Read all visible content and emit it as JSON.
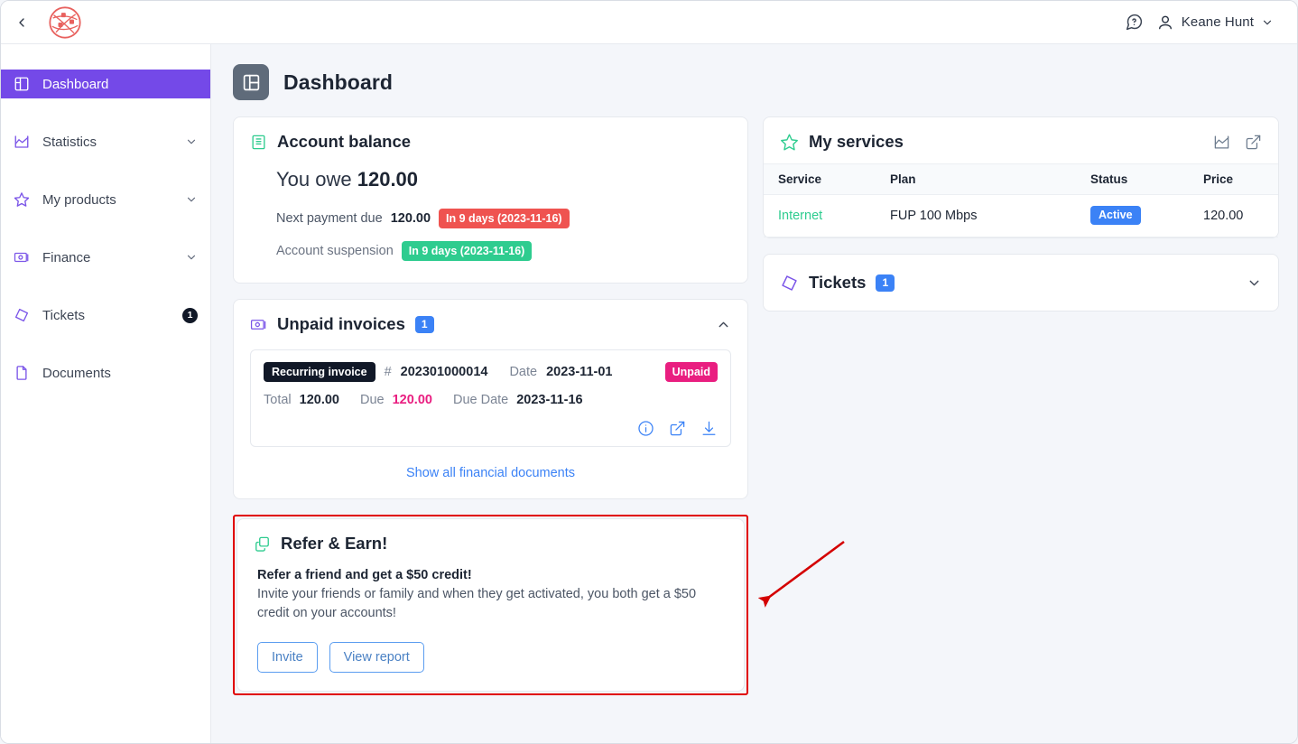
{
  "topbar": {
    "back_icon": "chevron-left-icon",
    "logo_alt": "network-globe-logo",
    "help_icon": "help-circle-icon",
    "user_icon": "user-icon",
    "user_name": "Keane Hunt",
    "user_chevron": "chevron-down-icon"
  },
  "sidebar": {
    "items": [
      {
        "label": "Dashboard",
        "icon": "dashboard-icon",
        "active": true,
        "chevron": false,
        "badge": null
      },
      {
        "label": "Statistics",
        "icon": "chart-icon",
        "active": false,
        "chevron": true,
        "badge": null
      },
      {
        "label": "My products",
        "icon": "star-icon",
        "active": false,
        "chevron": true,
        "badge": null
      },
      {
        "label": "Finance",
        "icon": "money-icon",
        "active": false,
        "chevron": true,
        "badge": null
      },
      {
        "label": "Tickets",
        "icon": "ticket-icon",
        "active": false,
        "chevron": false,
        "badge": "1"
      },
      {
        "label": "Documents",
        "icon": "document-icon",
        "active": false,
        "chevron": false,
        "badge": null
      }
    ]
  },
  "page": {
    "title": "Dashboard",
    "icon": "dashboard-panel-icon"
  },
  "account_balance": {
    "title": "Account balance",
    "icon": "book-icon",
    "owe_label": "You owe",
    "owe_amount": "120.00",
    "next_payment_label": "Next payment due",
    "next_payment_amount": "120.00",
    "next_payment_pill": "In 9 days (2023-11-16)",
    "next_payment_pill_color": "#ef5350",
    "suspension_label": "Account suspension",
    "suspension_pill": "In 9 days (2023-11-16)",
    "suspension_pill_color": "#2ecc8f"
  },
  "unpaid_invoices": {
    "title": "Unpaid invoices",
    "icon": "money-icon",
    "count": "1",
    "collapse_icon": "chevron-up-icon",
    "invoice": {
      "type_tag": "Recurring invoice",
      "number_label": "#",
      "number": "202301000014",
      "date_label": "Date",
      "date": "2023-11-01",
      "status": "Unpaid",
      "status_color": "#e91e80",
      "total_label": "Total",
      "total": "120.00",
      "due_label": "Due",
      "due": "120.00",
      "due_date_label": "Due Date",
      "due_date": "2023-11-16",
      "actions": [
        "info-icon",
        "external-link-icon",
        "download-icon"
      ]
    },
    "footer_link": "Show all financial documents"
  },
  "refer_earn": {
    "title": "Refer & Earn!",
    "icon": "copy-icon",
    "headline": "Refer a friend and get a $50 credit!",
    "body": "Invite your friends or family and when they get activated, you both get a $50 credit on your accounts!",
    "buttons": [
      {
        "label": "Invite"
      },
      {
        "label": "View report"
      }
    ],
    "highlight_color": "#e00000"
  },
  "my_services": {
    "title": "My services",
    "icon": "star-icon",
    "actions": [
      "chart-icon",
      "external-link-icon"
    ],
    "columns": [
      "Service",
      "Plan",
      "Status",
      "Price"
    ],
    "rows": [
      {
        "service": "Internet",
        "plan": "FUP 100 Mbps",
        "status": "Active",
        "status_color": "#3b82f6",
        "price": "120.00"
      }
    ]
  },
  "tickets_panel": {
    "title": "Tickets",
    "icon": "ticket-icon",
    "count": "1",
    "expand_icon": "chevron-down-icon"
  }
}
